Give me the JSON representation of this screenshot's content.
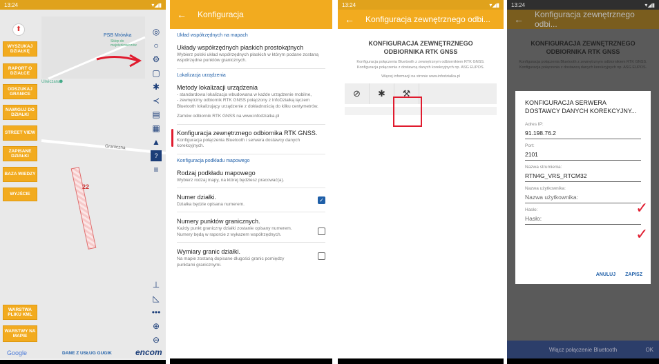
{
  "p1": {
    "status": "13:24",
    "poi": "PSB Mrówka",
    "poi_sub": "Sklep do majsterkowiczów",
    "street": "Graniczna",
    "plot_no": "22",
    "place": "Ulwiczana",
    "buttons": [
      "WYSZUKAJ DZIAŁKĘ",
      "RAPORT O DZIAŁCE",
      "ODSZUKAJ GRANICE",
      "NAWIGUJ DO DZIAŁKI",
      "STREET VIEW",
      "ZAPISANE DZIAŁKI",
      "BAZA WIEDZY",
      "WYJŚCIE"
    ],
    "bottom_buttons": [
      "WARSTWA PLIKU KML",
      "WARSTWY NA MAPIE"
    ],
    "google": "Google",
    "services": "DANE Z USŁUG GUGIK",
    "brand": "encom"
  },
  "p2": {
    "title": "Konfiguracja",
    "sec1": "Układ współrzędnych na mapach",
    "i1_t": "Układy współrzędnych płaskich prostokątnych",
    "i1_s": "Wybierz polski układ współrzędnych płaskich w którym podane zostaną współrzędne punktów granicznych.",
    "sec2": "Lokalizacja urządzenia",
    "i2_t": "Metody lokalizacji urządzenia",
    "i2_s": "- standardowa lokalizacja wbudowana w każde urządzenie mobilne,\n- zewnętrzny odbiornik RTK GNSS połączony z InfoDziałką łączem Bluetooth lokalizujący urządzenie z dokładnością do kilku centymetrów.",
    "i2_l": "Zamów odbiornik RTK GNSS na www.infodzialka.pl",
    "i3_t": "Konfiguracja zewnętrznego odbiornika RTK GNSS.",
    "i3_s": "Konfiguracja połączenia Bluetooth i serwera dostawcy danych korekcyjnych.",
    "sec3": "Konfiguracja podkładu mapowego",
    "i4_t": "Rodzaj podkładu mapowego",
    "i4_s": "Wybierz rodzaj mapy, na której będziesz pracować(a).",
    "i5_t": "Numer działki.",
    "i5_s": "Działka będzie opisana numerem.",
    "i6_t": "Numery punktów granicznych.",
    "i6_s": "Każdy punkt graniczny działki zostanie opisany numerem. Numery będą w raporcie z wykazem współrzędnych.",
    "i7_t": "Wymiary granic działki.",
    "i7_s": "Na mapie zostaną dopisane długości granic pomiędzy punktami granicznymi."
  },
  "p3": {
    "status": "13:24",
    "title": "Konfiguracja zewnętrznego odbi...",
    "heading": "KONFIGURACJA ZEWNĘTRZNEGO ODBIORNIKA RTK GNSS",
    "sub": "Konfiguracja połączenia Bluetooth z zewnętrznym odbiornikiem RTK GNSS. Konfiguracja połączenia z dostawcą danych korekcyjnych np. ASG EUPOS.",
    "more": "Więcej informacji na stronie www.infodzialka.pl"
  },
  "p4": {
    "status": "13:24",
    "title": "Konfiguracja zewnętrznego odbi...",
    "bg_heading": "KONFIGURACJA ZEWNĘTRZNEGO ODBIORNIKA RTK GNSS",
    "bg_sub": "Konfiguracja połączenia Bluetooth z zewnętrznym odbiornikiem RTK GNSS. Konfiguracja połączenia z dostawcą danych korekcyjnych np. ASG EUPOS.",
    "dialog_title": "KONFIGURACJA SERWERA DOSTAWCY DANYCH KOREKCYJNY...",
    "l_ip": "Adres IP:",
    "v_ip": "91.198.76.2",
    "l_port": "Port:",
    "v_port": "2101",
    "l_stream": "Nazwa strumienia:",
    "v_stream": "RTN4G_VRS_RTCM32",
    "l_user": "Nazwa użytkownika:",
    "ph_user": "Nazwa użytkownika:",
    "l_pass": "Hasło:",
    "ph_pass": "Hasło:",
    "cancel": "ANULUJ",
    "save": "ZAPISZ",
    "bt": "Włącz połączenie Bluetooth",
    "ok": "OK"
  }
}
